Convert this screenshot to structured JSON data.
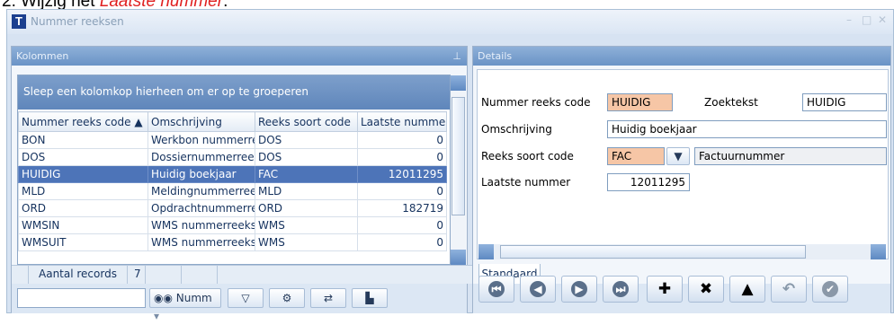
{
  "instruction": {
    "prefix": "2. Wijzig het ",
    "highlight": "Laatste nummer",
    "suffix": "."
  },
  "window": {
    "title": "Nummer reeksen",
    "app_icon_letter": "T"
  },
  "left_panel": {
    "title": "Kolommen",
    "group_hint": "Sleep een kolomkop hierheen om er op te groeperen",
    "columns": [
      "Nummer reeks code",
      "Omschrijving",
      "Reeks soort code",
      "Laatste nummer"
    ],
    "sort_indicator": "▲",
    "rows": [
      {
        "code": "BON",
        "desc": "Werkbon nummerreeks",
        "type": "DOS",
        "last": "0"
      },
      {
        "code": "DOS",
        "desc": "Dossiernummerreeks",
        "type": "DOS",
        "last": "0"
      },
      {
        "code": "HUIDIG",
        "desc": "Huidig boekjaar",
        "type": "FAC",
        "last": "12011295"
      },
      {
        "code": "MLD",
        "desc": "Meldingnummerreeks",
        "type": "MLD",
        "last": "0"
      },
      {
        "code": "ORD",
        "desc": "Opdrachtnummerreeks",
        "type": "ORD",
        "last": "182719"
      },
      {
        "code": "WMSIN",
        "desc": "WMS nummerreeks in",
        "type": "WMS",
        "last": "0"
      },
      {
        "code": "WMSUIT",
        "desc": "WMS nummerreeks uit",
        "type": "WMS",
        "last": "0"
      }
    ],
    "selected_row": 2,
    "status": {
      "label": "Aantal records",
      "count": "7"
    },
    "toolbar": {
      "search_value": "",
      "field_button": "Numm"
    }
  },
  "right_panel": {
    "title": "Details",
    "fields": {
      "code_label": "Nummer reeks code",
      "code_value": "HUIDIG",
      "search_label": "Zoektekst",
      "search_value": "HUIDIG",
      "desc_label": "Omschrijving",
      "desc_value": "Huidig boekjaar",
      "type_label": "Reeks soort code",
      "type_value": "FAC",
      "type_desc": "Factuurnummer",
      "last_label": "Laatste nummer",
      "last_value": "12011295"
    },
    "tab": "Standaard"
  },
  "icons": [
    "binoculars-icon",
    "filter-icon",
    "settings-icon",
    "refresh-icon",
    "export-icon",
    "first-icon",
    "previous-icon",
    "next-icon",
    "last-icon",
    "add-icon",
    "delete-icon",
    "up-icon",
    "undo-icon",
    "confirm-icon"
  ]
}
